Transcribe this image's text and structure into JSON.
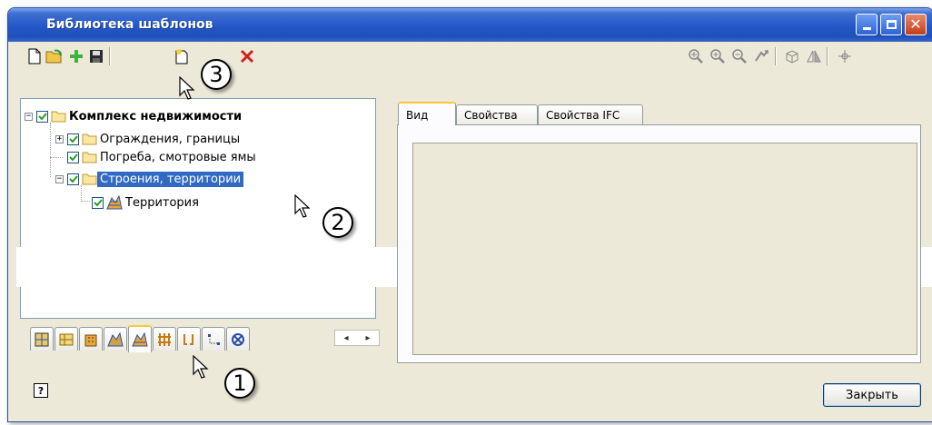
{
  "window": {
    "title": "Библиотека шаблонов"
  },
  "tree": {
    "items": [
      {
        "label": "Комплекс недвижимости",
        "expander": "−",
        "checked": true,
        "icon": "folder-icon",
        "bold": true
      },
      {
        "label": "Ограждения, границы",
        "expander": "+",
        "checked": true,
        "icon": "folder-icon"
      },
      {
        "label": "Погреба, смотровые ямы",
        "expander": "",
        "checked": true,
        "icon": "folder-icon"
      },
      {
        "label": "Строения, территории",
        "expander": "−",
        "checked": true,
        "icon": "folder-icon",
        "selected": true
      },
      {
        "label": "Территория",
        "expander": "",
        "checked": true,
        "icon": "territory-icon"
      }
    ]
  },
  "tabs": [
    {
      "label": "Вид",
      "active": true
    },
    {
      "label": "Свойства"
    },
    {
      "label": "Свойства IFC"
    }
  ],
  "buttons": {
    "close": "Закрыть"
  },
  "help": {
    "glyph": "?"
  },
  "callouts": {
    "one": "1",
    "two": "2",
    "three": "3"
  },
  "bottom_tabs": [
    "map-tab-icon",
    "plan-tab-icon",
    "building-tab-icon",
    "terrain-tab-icon",
    "territory-tab-icon",
    "fence-tab-icon",
    "pipe-tab-icon",
    "points-tab-icon",
    "symbol-tab-icon"
  ],
  "colors": {
    "title_bar": "#2458c8",
    "selection": "#316ac5",
    "active_tab_accent": "#ffc73c",
    "face": "#ece9d8"
  }
}
